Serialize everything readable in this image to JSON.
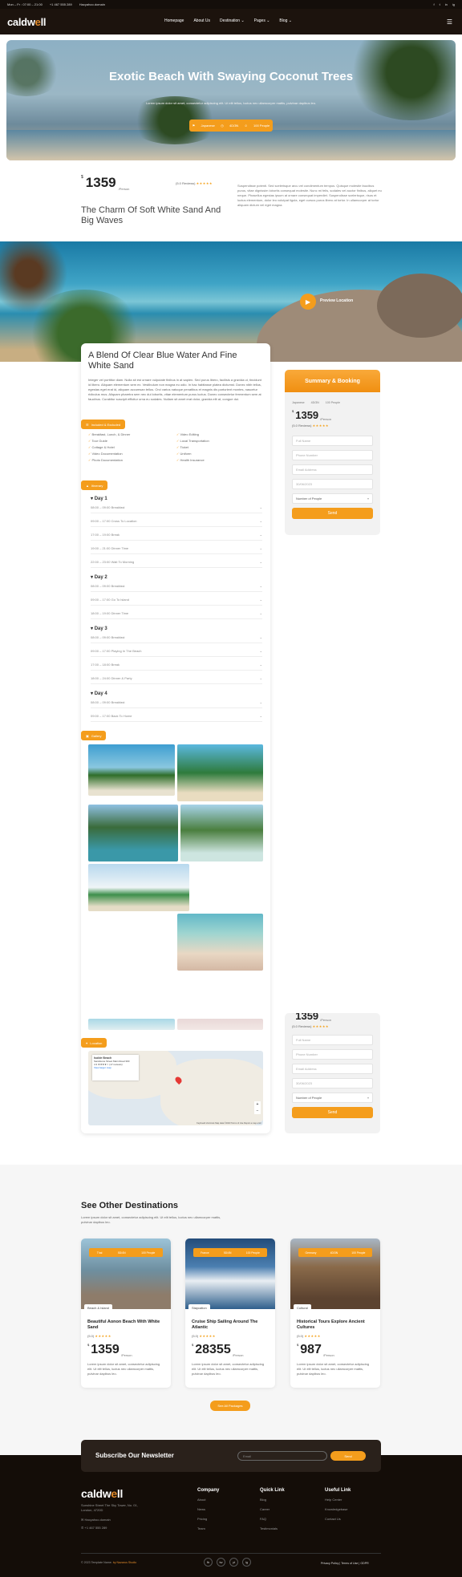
{
  "topbar": {
    "hours": "Mon – Fr : 07:00 – 21:00",
    "phone": "+1 467 555 289",
    "email": "Hacyahoo.domain",
    "social": [
      "f",
      "t",
      "in",
      "ig"
    ]
  },
  "nav": {
    "logo_a": "caldw",
    "logo_b": "e",
    "logo_c": "ll",
    "items": [
      "Homepage",
      "About Us",
      "Destination ⌄",
      "Pages ⌄",
      "Blog ⌄"
    ]
  },
  "hero": {
    "title": "Exotic Beach With Swaying Coconut Trees",
    "desc": "Lorem ipsum dolor sit amet, consectetur adipiscing elit. Ut elit tellus, luctus nec ullamcorper mattis, pulvinar dapibus leo.",
    "tags": [
      "Japanese",
      "4D/3N",
      "100 People"
    ]
  },
  "tour": {
    "currency": "$",
    "price": "1359",
    "per": "/Person",
    "reviews": "(5.0 Reviews)",
    "stars": "★★★★★",
    "heading": "The Charm Of Soft White Sand And Big Waves",
    "desc": "Suspendisse potenti. Sed scelerisque arcu vel condimentum tempus. Quisque molestie faucibus purus, vitae dignissim lobortis consequat molestie. Nunc mi felis, sodales vel auctor finibus, aliquet eu neque. Phasellus egestas ipsum at ornare consequat imperdiet. Suspendisse scelerisque, risus et luctus elementum, dolor leo volutpat ligula, eget cursus purus libero at tortor. In ullamcorper at tortor aliquam dictum vel eget magna."
  },
  "banner": {
    "preview": "Preview Location"
  },
  "main": {
    "heading": "A Blend Of Clear Blue Water And Fine White Sand",
    "desc": "Integer vel porttitor diam. Nulla sit est ornare vulputate finibus in at sapien. Sed purus libero, facilisis a gravida ut, tincidunt id libero. Aliquam elementum sem ex. Vestibulum non magna eu odio. In hac habitasse platea dictumst. Donec nibh tellus, egestas eget erat id, aliquam accumsan tellus. Orci varius natoque penatibus et magnis dis parturient montes, nascetur ridiculus mus. Aliquam pharetra sem nec dui lobortis, vitae elementum purus luctus. Donec consectetur fermentum sem at faucibus. Curabitur suscipit efficitur urna eu sodales. Nullam sit amet erat dolor, gravida elit at, congue dui.",
    "included_label": "Included & Excluded",
    "included": [
      "Breakfast, Lunch, & Dinner",
      "Video Editing",
      "Tour Guide",
      "Local Transportation",
      "Cottage & Hotel",
      "Ticket",
      "Video Documentation",
      "Uniform",
      "Photo Documentation",
      "Health Insurance"
    ],
    "itinerary_label": "Itinerary",
    "days": [
      {
        "name": "Day 1",
        "items": [
          "08:00 – 09:00 Breakfast",
          "09:00 – 17:00 Cross To Location",
          "17:00 – 19:00 Break",
          "19:00 – 21:00 Dinner Time",
          "22:00 – 23:00 Wait To Morning"
        ]
      },
      {
        "name": "Day 2",
        "items": [
          "08:00 – 09:00 Breakfast",
          "09:00 – 17:00 Go To Island",
          "18:00 – 19:00 Dinner Time"
        ]
      },
      {
        "name": "Day 3",
        "items": [
          "08:00 – 09:00 Breakfast",
          "09:00 – 17:00 Playing In The Beach",
          "17:00 – 18:00 Break",
          "18:00 – 24:00 Dinner & Party"
        ]
      },
      {
        "name": "Day 4",
        "items": [
          "08:00 – 09:00 Breakfast",
          "09:00 – 17:00 Back To Home"
        ]
      }
    ],
    "gallery_label": "Gallery",
    "location_label": "Location",
    "map": {
      "place": "Isolde Beach",
      "addr": "Sandstone Street Main Road 300",
      "rating": "4.3",
      "reviews": "(17 reviews)",
      "link": "View larger map",
      "attribution": "Keyboard shortcuts  Map data ©2023  Terms of Use  Report a map error"
    }
  },
  "booking": {
    "title": "Summary & Booking",
    "tags": [
      "Japanese",
      "4D/3N",
      "100 People"
    ],
    "currency": "$",
    "price": "1359",
    "per": "/Person",
    "reviews": "(5.0 Reviews)",
    "stars": "★★★★★",
    "fields": [
      "Full Name",
      "Phone Number",
      "Email Address",
      "30/06/2023"
    ],
    "people": "Number of People",
    "send": "Send"
  },
  "other": {
    "title": "See Other Destinations",
    "desc": "Lorem ipsum dolor sit amet, consectetur adipiscing elit. Ut elit tellus, luctus nec ullamcorper mattis, pulvinar dapibus leo.",
    "cards": [
      {
        "tags": [
          "Thai",
          "5D/4N",
          "100 People"
        ],
        "cat": "Beach & Island",
        "title": "Beautiful Aonon Beach With White Sand",
        "rating": "(5.0)",
        "currency": "$",
        "price": "1359",
        "per": "/Person",
        "desc": "Lorem ipsum dolor sit amet, consectetur adipiscing elit. Ut elit tellus, luctus nec ullamcorper mattis, pulvinar dapibus leo."
      },
      {
        "tags": [
          "France",
          "5D/4N",
          "100 People"
        ],
        "cat": "Staycation",
        "title": "Cruise Ship Sailing Around The Atlantic",
        "rating": "(5.0)",
        "currency": "$",
        "price": "28355",
        "per": "/Person",
        "desc": "Lorem ipsum dolor sit amet, consectetur adipiscing elit. Ut elit tellus, luctus nec ullamcorper mattis, pulvinar dapibus leo."
      },
      {
        "tags": [
          "Germany",
          "4D/3N",
          "100 People"
        ],
        "cat": "Cultural",
        "title": "Historical Tours Explore Ancient Cultures",
        "rating": "(5.0)",
        "currency": "$",
        "price": "987",
        "per": "/Person",
        "desc": "Lorem ipsum dolor sit amet, consectetur adipiscing elit. Ut elit tellus, luctus nec ullamcorper mattis, pulvinar dapibus leo."
      }
    ],
    "see_all": "See All Packages"
  },
  "newsletter": {
    "title": "Subscribe Our Newsletter",
    "placeholder": "Email",
    "button": "Send"
  },
  "footer": {
    "address": "Sunshine Street The Sky Tower, No. 01, London, 4720D",
    "email": "Hacyahoo.domain",
    "phone": "+1 467 555 289",
    "company_title": "Company",
    "company": [
      "About",
      "News",
      "Pricing",
      "Team"
    ],
    "quick_title": "Quick Link",
    "quick": [
      "Blog",
      "Career",
      "FAQ",
      "Testimonials"
    ],
    "useful_title": "Useful Link",
    "useful": [
      "Help Center",
      "Knowledgebase",
      "Contact Us"
    ],
    "copyright": "© 2023 Template Name.",
    "by": "by Nazarus Studio",
    "social": [
      "fb",
      "tw",
      "yt",
      "ig"
    ],
    "legal": "Privacy Policy  |  Terms of Use  |  GDPR"
  },
  "colors": {
    "accent": "#f49d1c",
    "dark": "#140e0a"
  }
}
